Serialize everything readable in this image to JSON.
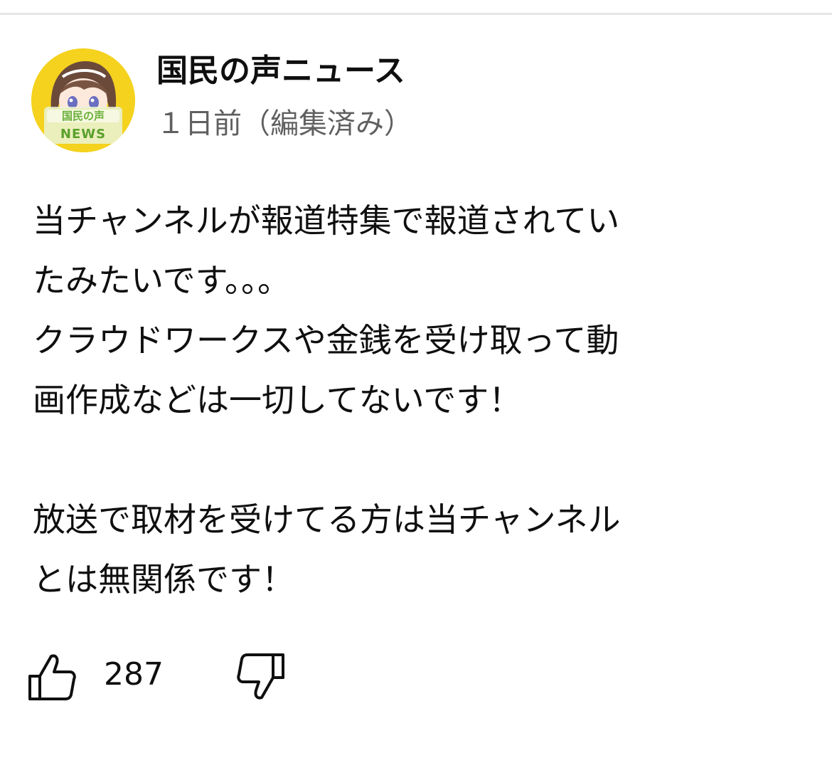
{
  "comment": {
    "author": "国民の声ニュース",
    "meta": "１日前（編集済み）",
    "avatar": {
      "label": "国民の声",
      "sub_label": "NEWS",
      "bg_color": "#f4d21e"
    },
    "body_lines": [
      "当チャンネルが報道特集で報道されてい",
      "たみたいです。。。",
      "クラウドワークスや金銭を受け取って動",
      "画作成などは一切してないです！",
      "",
      "放送で取材を受けてる方は当チャンネル",
      "とは無関係です！"
    ],
    "actions": {
      "like_icon": "thumbs-up-icon",
      "like_count": "287",
      "dislike_icon": "thumbs-down-icon"
    }
  }
}
